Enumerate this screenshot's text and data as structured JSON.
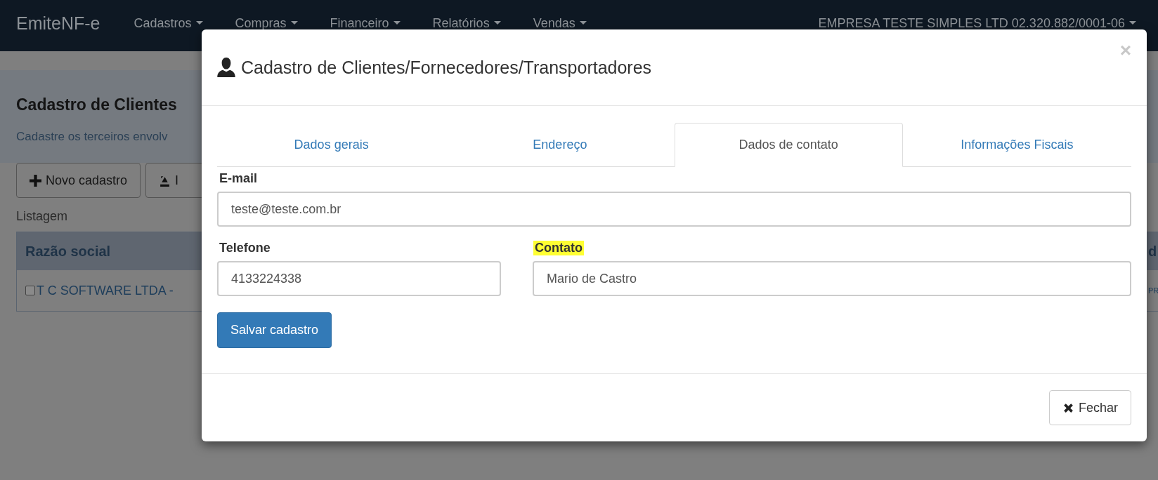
{
  "navbar": {
    "brand": "EmiteNF-e",
    "menus": [
      {
        "label": "Cadastros"
      },
      {
        "label": "Compras"
      },
      {
        "label": "Financeiro"
      },
      {
        "label": "Relatórios"
      },
      {
        "label": "Vendas"
      }
    ],
    "company": "EMPRESA TESTE SIMPLES LTD 02.320.882/0001-06"
  },
  "page": {
    "title": "Cadastro de Clientes",
    "subtitle": "Cadastre os terceiros envolv",
    "buttons": [
      "Novo cadastro",
      "I"
    ],
    "list_label": "Listagem",
    "table": {
      "columns": [
        "Razão social",
        "d"
      ],
      "rows": [
        {
          "cells": [
            "T C SOFTWARE LTDA -",
            "PR"
          ],
          "checked": false
        }
      ]
    }
  },
  "modal": {
    "title": "Cadastro de Clientes/Fornecedores/Transportadores",
    "close": "×",
    "tabs": [
      {
        "label": "Dados gerais",
        "selected": false
      },
      {
        "label": "Endereço",
        "selected": false
      },
      {
        "label": "Dados de contato",
        "selected": true
      },
      {
        "label": "Informações Fiscais",
        "selected": false
      }
    ],
    "email": {
      "label": "E-mail",
      "value": "teste@teste.com.br",
      "highlighted": false
    },
    "telefone": {
      "label": "Telefone",
      "value": "4133224338",
      "highlighted": false
    },
    "contato": {
      "label": "Contato",
      "value": "Mario de Castro",
      "highlighted": true
    },
    "save_button": "Salvar cadastro",
    "close_button": "Fechar"
  }
}
